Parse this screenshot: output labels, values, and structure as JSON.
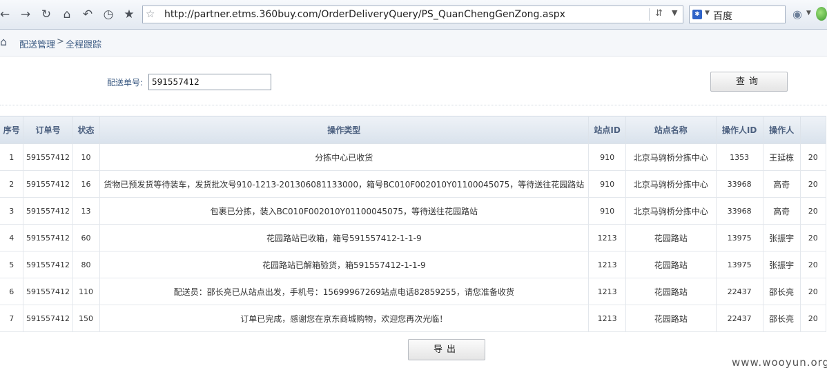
{
  "browser": {
    "url": "http://partner.etms.360buy.com/OrderDeliveryQuery/PS_QuanChengGenZong.aspx",
    "search_engine": "百度",
    "nav_icons": [
      "back-arrow-icon",
      "forward-arrow-icon",
      "refresh-icon",
      "home-icon",
      "undo-icon",
      "history-icon",
      "bookmark-star-icon"
    ]
  },
  "breadcrumb": {
    "parent": "配送管理",
    "separator": ">",
    "current": "全程跟踪"
  },
  "query": {
    "label": "配送单号:",
    "value": "591557412",
    "button": "查询"
  },
  "table": {
    "columns": [
      "序号",
      "订单号",
      "状态",
      "操作类型",
      "站点ID",
      "站点名称",
      "操作人ID",
      "操作人",
      ""
    ],
    "rows": [
      [
        "1",
        "591557412",
        "10",
        "分拣中心已收货",
        "910",
        "北京马驹桥分拣中心",
        "1353",
        "王延栋",
        "20"
      ],
      [
        "2",
        "591557412",
        "16",
        "货物已预发货等待装车，发货批次号910-1213-201306081133000，箱号BC010F002010Y01100045075，等待送往花园路站",
        "910",
        "北京马驹桥分拣中心",
        "33968",
        "高奇",
        "20"
      ],
      [
        "3",
        "591557412",
        "13",
        "包裹已分拣，装入BC010F002010Y01100045075，等待送往花园路站",
        "910",
        "北京马驹桥分拣中心",
        "33968",
        "高奇",
        "20"
      ],
      [
        "4",
        "591557412",
        "60",
        "花园路站已收箱，箱号591557412-1-1-9",
        "1213",
        "花园路站",
        "13975",
        "张振宇",
        "20"
      ],
      [
        "5",
        "591557412",
        "80",
        "花园路站已解箱验货，箱591557412-1-1-9",
        "1213",
        "花园路站",
        "13975",
        "张振宇",
        "20"
      ],
      [
        "6",
        "591557412",
        "110",
        "配送员：邵长亮已从站点出发，手机号：15699967269站点电话82859255，请您准备收货",
        "1213",
        "花园路站",
        "22437",
        "邵长亮",
        "20"
      ],
      [
        "7",
        "591557412",
        "150",
        "订单已完成，感谢您在京东商城购物，欢迎您再次光临！",
        "1213",
        "花园路站",
        "22437",
        "邵长亮",
        "20"
      ]
    ]
  },
  "export_button": "导出",
  "watermark": "www.wooyun.org"
}
